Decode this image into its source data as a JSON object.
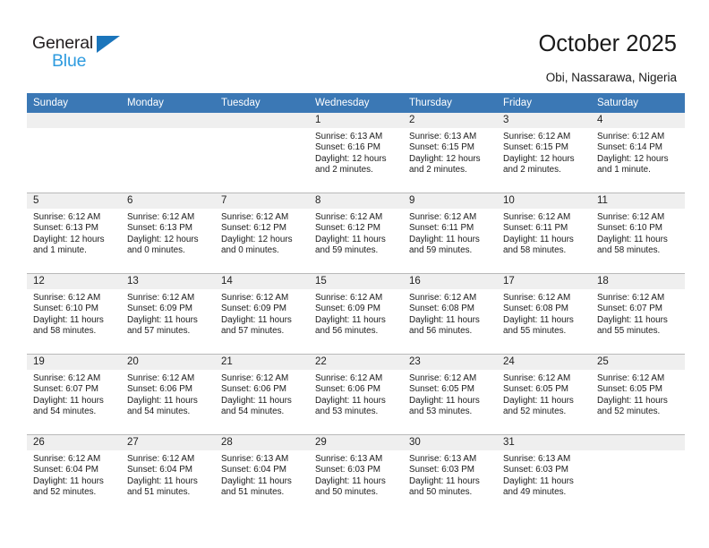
{
  "brand": {
    "name_top": "General",
    "name_bottom": "Blue",
    "triangle_color": "#1b75bb",
    "text_color_top": "#231f20",
    "text_color_bottom": "#2e9bdf"
  },
  "header": {
    "title": "October 2025",
    "subtitle": "Obi, Nassarawa, Nigeria"
  },
  "calendar": {
    "header_background": "#3b78b5",
    "header_text_color": "#ffffff",
    "daynum_background": "#efefef",
    "weekday_headers": [
      "Sunday",
      "Monday",
      "Tuesday",
      "Wednesday",
      "Thursday",
      "Friday",
      "Saturday"
    ],
    "weeks": [
      [
        {
          "day": "",
          "sunrise": "",
          "sunset": "",
          "daylight_line1": "",
          "daylight_line2": ""
        },
        {
          "day": "",
          "sunrise": "",
          "sunset": "",
          "daylight_line1": "",
          "daylight_line2": ""
        },
        {
          "day": "",
          "sunrise": "",
          "sunset": "",
          "daylight_line1": "",
          "daylight_line2": ""
        },
        {
          "day": "1",
          "sunrise": "Sunrise: 6:13 AM",
          "sunset": "Sunset: 6:16 PM",
          "daylight_line1": "Daylight: 12 hours",
          "daylight_line2": "and 2 minutes."
        },
        {
          "day": "2",
          "sunrise": "Sunrise: 6:13 AM",
          "sunset": "Sunset: 6:15 PM",
          "daylight_line1": "Daylight: 12 hours",
          "daylight_line2": "and 2 minutes."
        },
        {
          "day": "3",
          "sunrise": "Sunrise: 6:12 AM",
          "sunset": "Sunset: 6:15 PM",
          "daylight_line1": "Daylight: 12 hours",
          "daylight_line2": "and 2 minutes."
        },
        {
          "day": "4",
          "sunrise": "Sunrise: 6:12 AM",
          "sunset": "Sunset: 6:14 PM",
          "daylight_line1": "Daylight: 12 hours",
          "daylight_line2": "and 1 minute."
        }
      ],
      [
        {
          "day": "5",
          "sunrise": "Sunrise: 6:12 AM",
          "sunset": "Sunset: 6:13 PM",
          "daylight_line1": "Daylight: 12 hours",
          "daylight_line2": "and 1 minute."
        },
        {
          "day": "6",
          "sunrise": "Sunrise: 6:12 AM",
          "sunset": "Sunset: 6:13 PM",
          "daylight_line1": "Daylight: 12 hours",
          "daylight_line2": "and 0 minutes."
        },
        {
          "day": "7",
          "sunrise": "Sunrise: 6:12 AM",
          "sunset": "Sunset: 6:12 PM",
          "daylight_line1": "Daylight: 12 hours",
          "daylight_line2": "and 0 minutes."
        },
        {
          "day": "8",
          "sunrise": "Sunrise: 6:12 AM",
          "sunset": "Sunset: 6:12 PM",
          "daylight_line1": "Daylight: 11 hours",
          "daylight_line2": "and 59 minutes."
        },
        {
          "day": "9",
          "sunrise": "Sunrise: 6:12 AM",
          "sunset": "Sunset: 6:11 PM",
          "daylight_line1": "Daylight: 11 hours",
          "daylight_line2": "and 59 minutes."
        },
        {
          "day": "10",
          "sunrise": "Sunrise: 6:12 AM",
          "sunset": "Sunset: 6:11 PM",
          "daylight_line1": "Daylight: 11 hours",
          "daylight_line2": "and 58 minutes."
        },
        {
          "day": "11",
          "sunrise": "Sunrise: 6:12 AM",
          "sunset": "Sunset: 6:10 PM",
          "daylight_line1": "Daylight: 11 hours",
          "daylight_line2": "and 58 minutes."
        }
      ],
      [
        {
          "day": "12",
          "sunrise": "Sunrise: 6:12 AM",
          "sunset": "Sunset: 6:10 PM",
          "daylight_line1": "Daylight: 11 hours",
          "daylight_line2": "and 58 minutes."
        },
        {
          "day": "13",
          "sunrise": "Sunrise: 6:12 AM",
          "sunset": "Sunset: 6:09 PM",
          "daylight_line1": "Daylight: 11 hours",
          "daylight_line2": "and 57 minutes."
        },
        {
          "day": "14",
          "sunrise": "Sunrise: 6:12 AM",
          "sunset": "Sunset: 6:09 PM",
          "daylight_line1": "Daylight: 11 hours",
          "daylight_line2": "and 57 minutes."
        },
        {
          "day": "15",
          "sunrise": "Sunrise: 6:12 AM",
          "sunset": "Sunset: 6:09 PM",
          "daylight_line1": "Daylight: 11 hours",
          "daylight_line2": "and 56 minutes."
        },
        {
          "day": "16",
          "sunrise": "Sunrise: 6:12 AM",
          "sunset": "Sunset: 6:08 PM",
          "daylight_line1": "Daylight: 11 hours",
          "daylight_line2": "and 56 minutes."
        },
        {
          "day": "17",
          "sunrise": "Sunrise: 6:12 AM",
          "sunset": "Sunset: 6:08 PM",
          "daylight_line1": "Daylight: 11 hours",
          "daylight_line2": "and 55 minutes."
        },
        {
          "day": "18",
          "sunrise": "Sunrise: 6:12 AM",
          "sunset": "Sunset: 6:07 PM",
          "daylight_line1": "Daylight: 11 hours",
          "daylight_line2": "and 55 minutes."
        }
      ],
      [
        {
          "day": "19",
          "sunrise": "Sunrise: 6:12 AM",
          "sunset": "Sunset: 6:07 PM",
          "daylight_line1": "Daylight: 11 hours",
          "daylight_line2": "and 54 minutes."
        },
        {
          "day": "20",
          "sunrise": "Sunrise: 6:12 AM",
          "sunset": "Sunset: 6:06 PM",
          "daylight_line1": "Daylight: 11 hours",
          "daylight_line2": "and 54 minutes."
        },
        {
          "day": "21",
          "sunrise": "Sunrise: 6:12 AM",
          "sunset": "Sunset: 6:06 PM",
          "daylight_line1": "Daylight: 11 hours",
          "daylight_line2": "and 54 minutes."
        },
        {
          "day": "22",
          "sunrise": "Sunrise: 6:12 AM",
          "sunset": "Sunset: 6:06 PM",
          "daylight_line1": "Daylight: 11 hours",
          "daylight_line2": "and 53 minutes."
        },
        {
          "day": "23",
          "sunrise": "Sunrise: 6:12 AM",
          "sunset": "Sunset: 6:05 PM",
          "daylight_line1": "Daylight: 11 hours",
          "daylight_line2": "and 53 minutes."
        },
        {
          "day": "24",
          "sunrise": "Sunrise: 6:12 AM",
          "sunset": "Sunset: 6:05 PM",
          "daylight_line1": "Daylight: 11 hours",
          "daylight_line2": "and 52 minutes."
        },
        {
          "day": "25",
          "sunrise": "Sunrise: 6:12 AM",
          "sunset": "Sunset: 6:05 PM",
          "daylight_line1": "Daylight: 11 hours",
          "daylight_line2": "and 52 minutes."
        }
      ],
      [
        {
          "day": "26",
          "sunrise": "Sunrise: 6:12 AM",
          "sunset": "Sunset: 6:04 PM",
          "daylight_line1": "Daylight: 11 hours",
          "daylight_line2": "and 52 minutes."
        },
        {
          "day": "27",
          "sunrise": "Sunrise: 6:12 AM",
          "sunset": "Sunset: 6:04 PM",
          "daylight_line1": "Daylight: 11 hours",
          "daylight_line2": "and 51 minutes."
        },
        {
          "day": "28",
          "sunrise": "Sunrise: 6:13 AM",
          "sunset": "Sunset: 6:04 PM",
          "daylight_line1": "Daylight: 11 hours",
          "daylight_line2": "and 51 minutes."
        },
        {
          "day": "29",
          "sunrise": "Sunrise: 6:13 AM",
          "sunset": "Sunset: 6:03 PM",
          "daylight_line1": "Daylight: 11 hours",
          "daylight_line2": "and 50 minutes."
        },
        {
          "day": "30",
          "sunrise": "Sunrise: 6:13 AM",
          "sunset": "Sunset: 6:03 PM",
          "daylight_line1": "Daylight: 11 hours",
          "daylight_line2": "and 50 minutes."
        },
        {
          "day": "31",
          "sunrise": "Sunrise: 6:13 AM",
          "sunset": "Sunset: 6:03 PM",
          "daylight_line1": "Daylight: 11 hours",
          "daylight_line2": "and 49 minutes."
        },
        {
          "day": "",
          "sunrise": "",
          "sunset": "",
          "daylight_line1": "",
          "daylight_line2": ""
        }
      ]
    ]
  }
}
